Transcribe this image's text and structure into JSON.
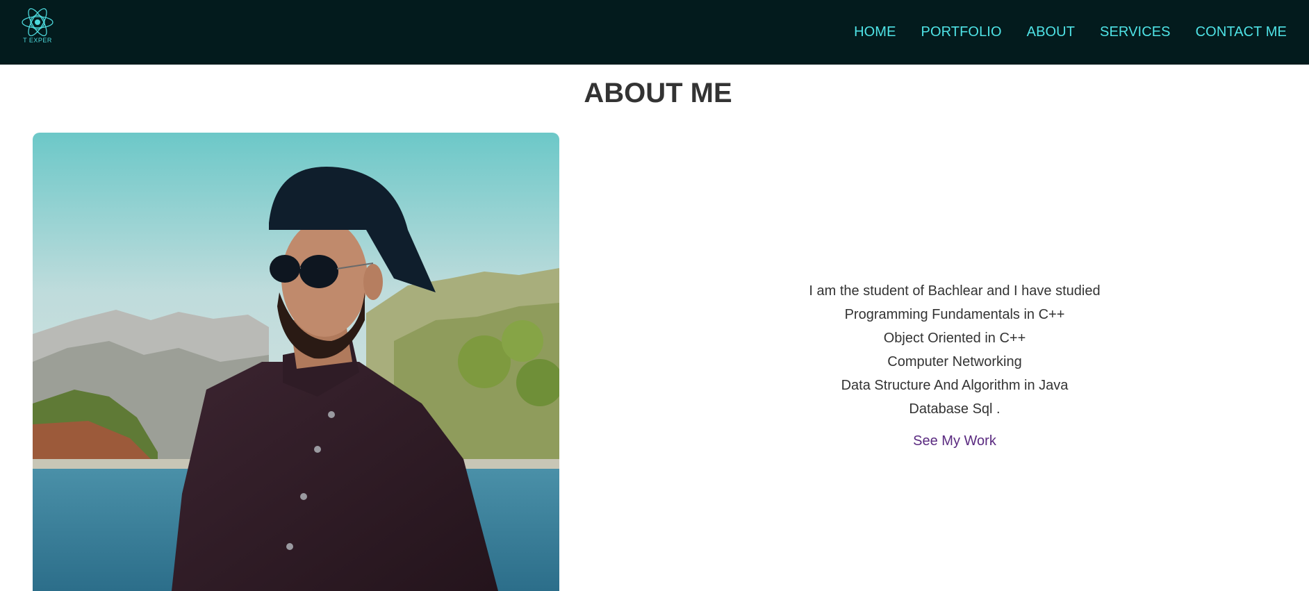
{
  "header": {
    "logo": {
      "text": "T EXPER",
      "subtext": "",
      "icon": "atom-logo-icon",
      "color": "#4dd9dc"
    },
    "nav": [
      {
        "label": "HOME"
      },
      {
        "label": "PORTFOLIO"
      },
      {
        "label": "ABOUT"
      },
      {
        "label": "SERVICES"
      },
      {
        "label": "CONTACT ME"
      }
    ],
    "background": "#031b1d",
    "link_color": "#4fe3e6"
  },
  "about": {
    "title": "ABOUT ME",
    "photo_alt": "portrait-photo",
    "lines": [
      "I am the student of Bachlear and I have studied",
      "Programming Fundamentals in C++",
      "Object Oriented in C++",
      "Computer Networking",
      "Data Structure And Algorithm in Java",
      "Database Sql ."
    ],
    "cta_label": "See My Work",
    "cta_color": "#5a2a80"
  }
}
